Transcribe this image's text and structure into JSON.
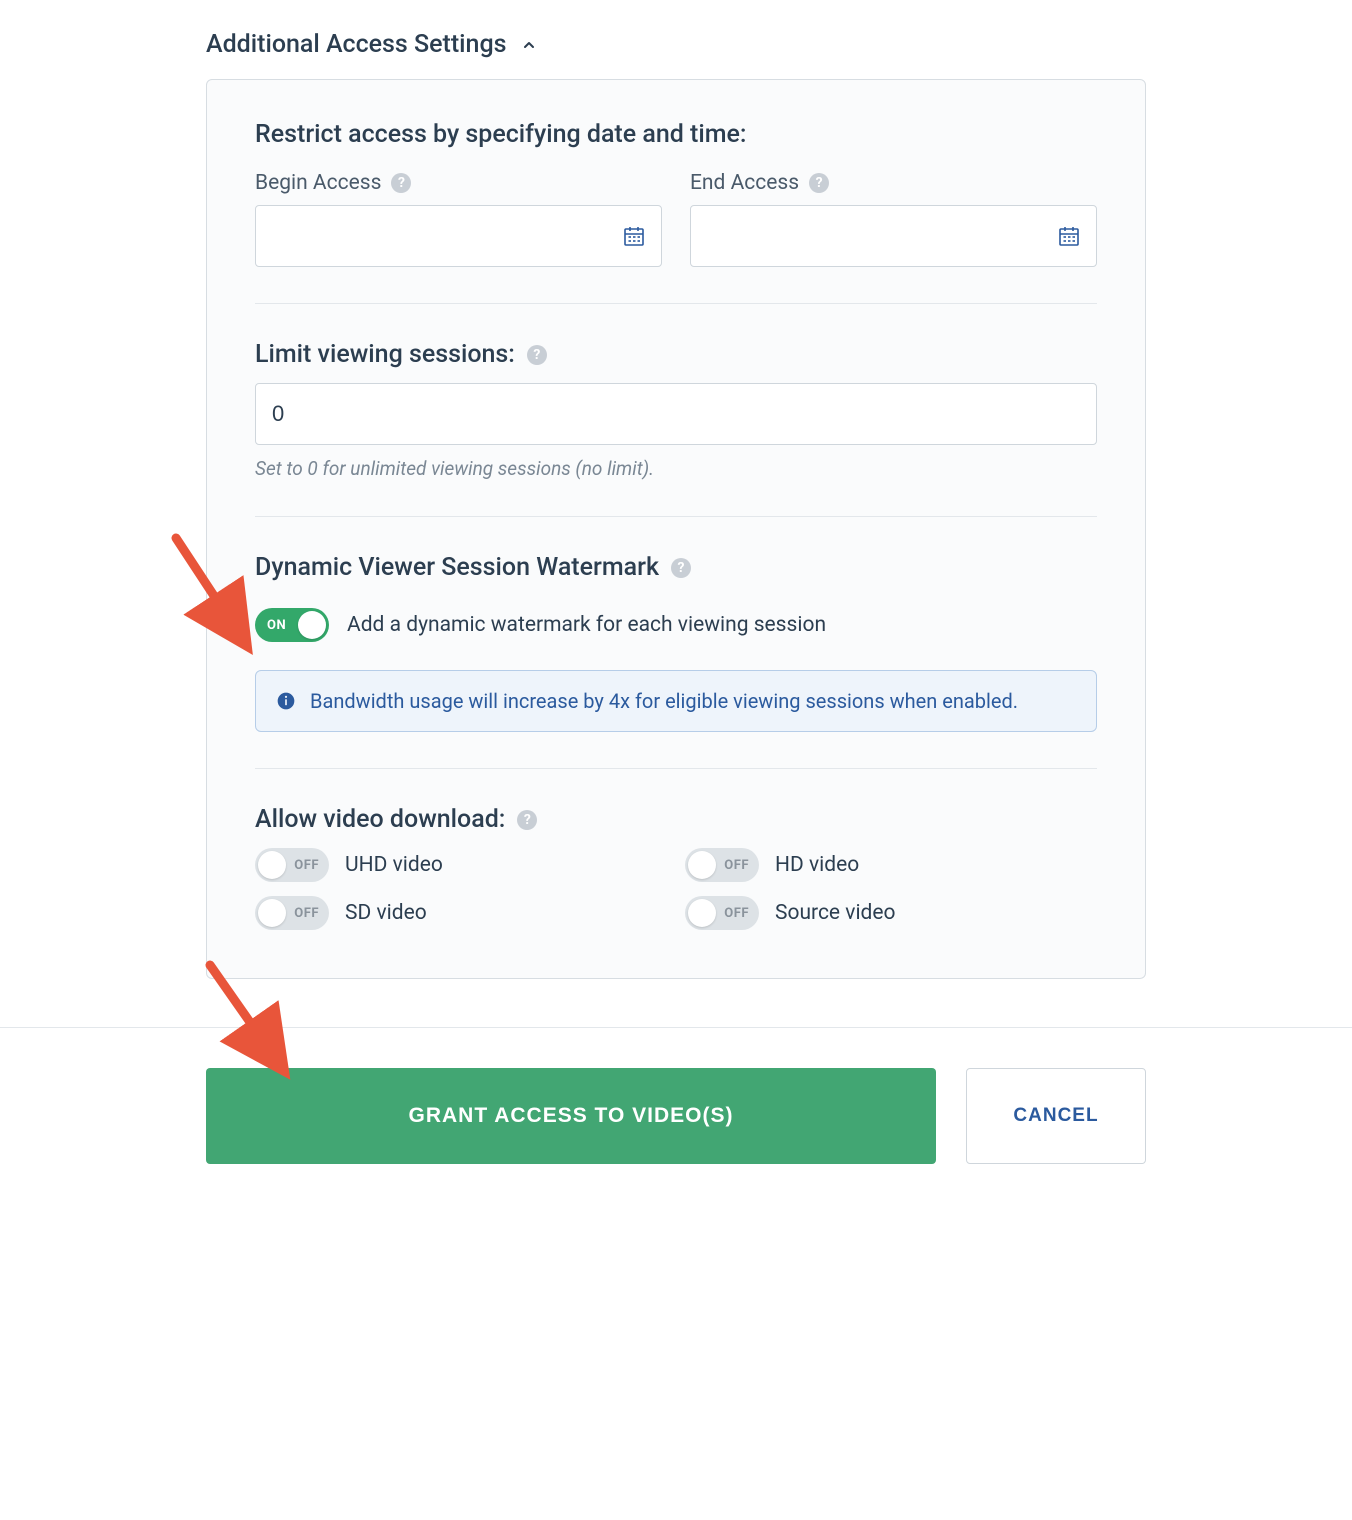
{
  "header": {
    "title": "Additional Access Settings"
  },
  "dateSection": {
    "title": "Restrict access by specifying date and time:",
    "beginLabel": "Begin Access",
    "endLabel": "End Access",
    "beginValue": "",
    "endValue": ""
  },
  "limitSection": {
    "title": "Limit viewing sessions:",
    "value": "0",
    "helper": "Set to 0 for unlimited viewing sessions (no limit)."
  },
  "watermarkSection": {
    "title": "Dynamic Viewer Session Watermark",
    "toggleState": "ON",
    "toggleDesc": "Add a dynamic watermark for each viewing session",
    "infoText": "Bandwidth usage will increase by 4x for eligible viewing sessions when enabled."
  },
  "downloadSection": {
    "title": "Allow video download:",
    "items": [
      {
        "label": "UHD video",
        "state": "OFF"
      },
      {
        "label": "HD video",
        "state": "OFF"
      },
      {
        "label": "SD video",
        "state": "OFF"
      },
      {
        "label": "Source video",
        "state": "OFF"
      }
    ]
  },
  "footer": {
    "primary": "GRANT ACCESS TO VIDEO(S)",
    "secondary": "CANCEL"
  }
}
